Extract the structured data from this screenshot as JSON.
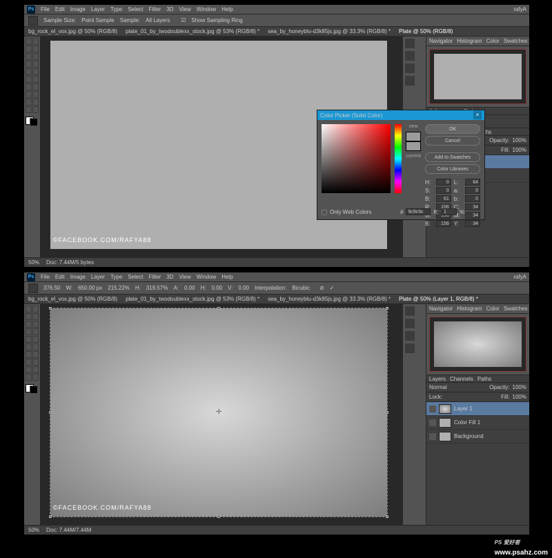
{
  "menu": {
    "items": [
      "File",
      "Edit",
      "Image",
      "Layer",
      "Type",
      "Select",
      "Filter",
      "3D",
      "View",
      "Window",
      "Help"
    ],
    "logo": "Ps",
    "user": "rafyA"
  },
  "optbar_top": {
    "sample_size_label": "Sample Size:",
    "sample_size": "Point Sample",
    "sample_label": "Sample:",
    "sample": "All Layers",
    "ring": "Show Sampling Ring"
  },
  "optbar_bot": {
    "x": "376.50",
    "w": "W:",
    "wval": "650.00 px",
    "pct1": "215.22%",
    "h": "H:",
    "pct2": "319.57%",
    "a": "A:",
    "aval": "0.00",
    "hh": "H:",
    "hval": "0.00",
    "v": "V:",
    "vval": "0.00",
    "intlabel": "Interpolation:",
    "int": "Bicubic"
  },
  "tabs": {
    "t1": "bg_rock_el_vox.jpg @ 50% (RGB/8)",
    "t2": "plate_01_by_twodoublexx_stock.jpg @ 53% (RGB/8) *",
    "t3": "sea_by_honeyblu-d3k85js.jpg @ 33.3% (RGB/8) *",
    "t4": "Plate @ 50% (RGB/8)",
    "t4b": "Plate @ 50% (Layer 1, RGB/8) *"
  },
  "panels": {
    "nav": "Navigator",
    "hist": "Histogram",
    "color": "Color",
    "swatches": "Swatches",
    "layers": "Layers",
    "channels": "Channels",
    "paths": "Paths",
    "adj": "Adjustments",
    "styles": "Styles"
  },
  "layer_panel": {
    "mode": "Normal",
    "opacity_label": "Opacity:",
    "opacity": "100%",
    "lock": "Lock:",
    "fill_label": "Fill:",
    "fill": "100%"
  },
  "layers_top": {
    "l1": "Color Fill 1",
    "l2": "Background"
  },
  "layers_bot": {
    "l0": "Layer 1",
    "l1": "Color Fill 1",
    "l2": "Background"
  },
  "status": {
    "zoom": "50%",
    "doc": "Doc: 7.44M/5 bytes",
    "doc2": "Doc: 7.44M/7.44M"
  },
  "watermark": "©FACEBOOK.COM/RAFYA88",
  "picker": {
    "title": "Color Picker (Solid Color)",
    "ok": "OK",
    "cancel": "Cancel",
    "addsw": "Add to Swatches",
    "lib": "Color Libraries",
    "new": "new",
    "current": "current",
    "only_web": "Only Web Colors",
    "hex_label": "#",
    "hex": "9c9c9c",
    "H": "H:",
    "Hv": "0",
    "S": "S:",
    "Sv": "0",
    "B": "B:",
    "Bv": "61",
    "L": "L:",
    "Lv": "64",
    "a": "a:",
    "av": "0",
    "b": "b:",
    "bv": "0",
    "R": "R:",
    "Rv": "156",
    "G": "G:",
    "Gv": "156",
    "Bl": "B:",
    "Blv": "156",
    "C": "C:",
    "Cv": "34",
    "M": "M:",
    "Mv": "34",
    "Y": "Y:",
    "Yv": "34",
    "K": "K:",
    "Kv": "1",
    "pct": "%"
  },
  "site": {
    "logo": "PS 爱好者",
    "url": "www.psahz.com"
  }
}
